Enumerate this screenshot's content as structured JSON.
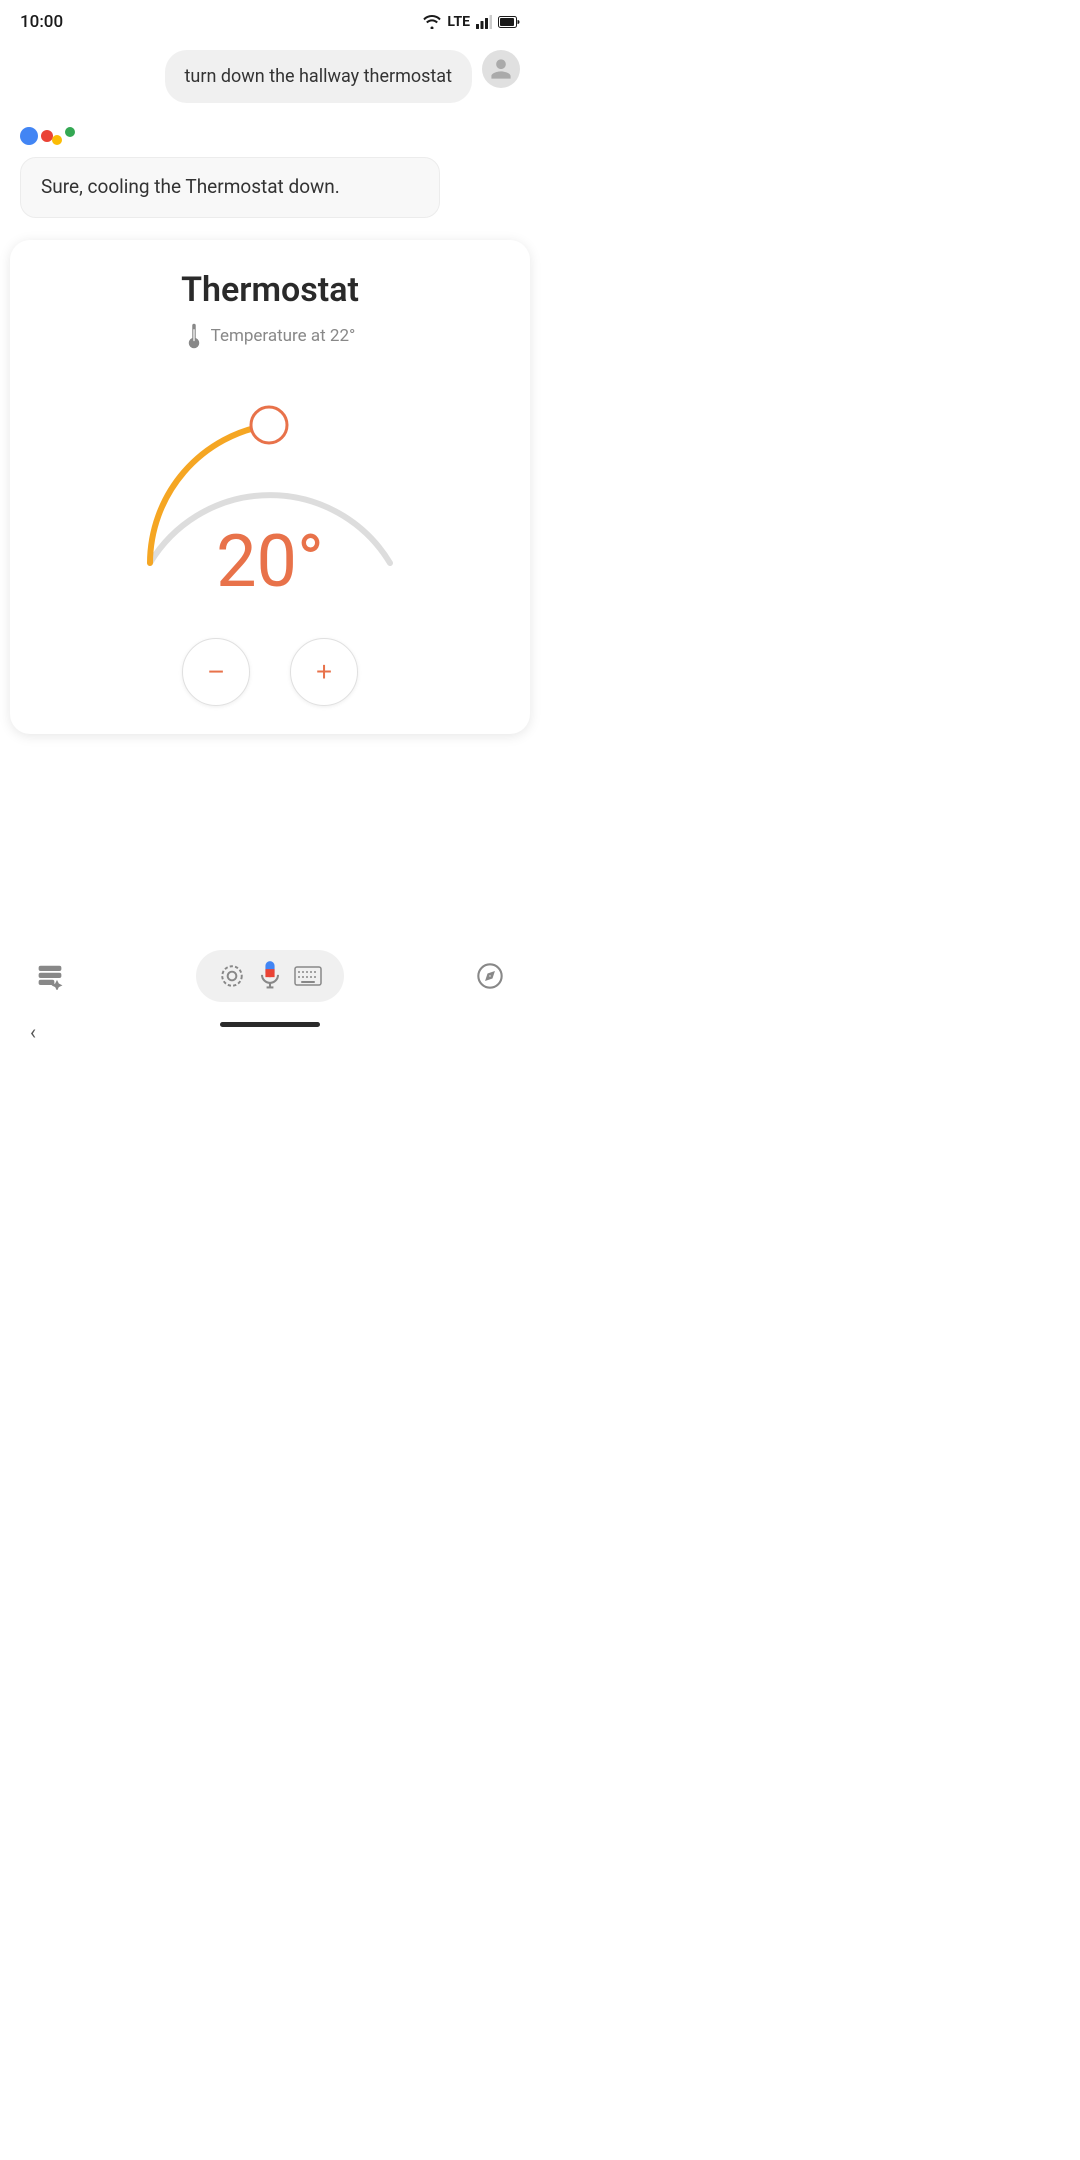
{
  "statusBar": {
    "time": "10:00",
    "networkLabel": "LTE"
  },
  "userMessage": {
    "text": "turn down the hallway thermostat"
  },
  "assistantMessage": {
    "text": "Sure, cooling the Thermostat down."
  },
  "thermostatCard": {
    "title": "Thermostat",
    "tempLabel": "Temperature at 22°",
    "currentTemp": "20°",
    "decrementLabel": "−",
    "incrementLabel": "+"
  },
  "icons": {
    "wifi": "wifi-icon",
    "lte": "lte-icon",
    "signal": "signal-icon",
    "battery": "battery-icon",
    "userAvatar": "user-avatar-icon",
    "thermometer": "thermometer-icon",
    "bottomMenu": "menu-icon",
    "bottomCamera": "camera-search-icon",
    "bottomMic": "microphone-icon",
    "bottomKeyboard": "keyboard-icon",
    "bottomCompass": "compass-icon",
    "backArrow": "back-arrow-icon",
    "homeIndicator": "home-indicator"
  }
}
